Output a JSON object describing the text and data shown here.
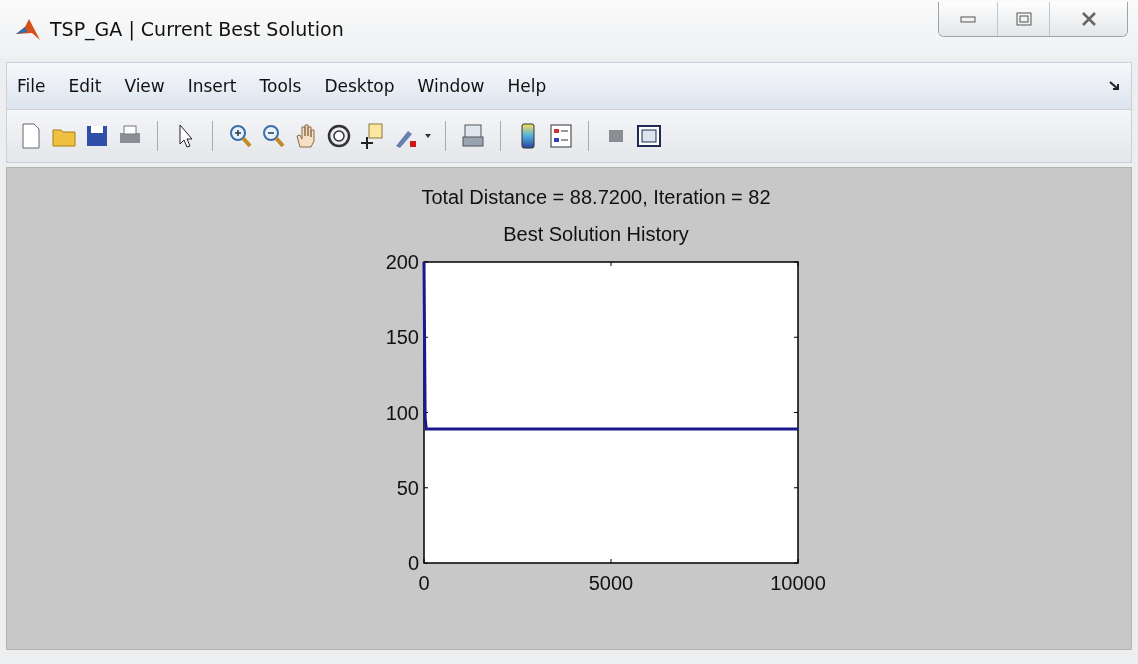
{
  "window": {
    "title": "TSP_GA | Current Best Solution"
  },
  "menu": [
    "File",
    "Edit",
    "View",
    "Insert",
    "Tools",
    "Desktop",
    "Window",
    "Help"
  ],
  "figure": {
    "heading": "Total Distance = 88.7200, Iteration = 82",
    "chart_data": {
      "type": "line",
      "title": "Best Solution History",
      "x": [
        0,
        30,
        60,
        10000
      ],
      "series": [
        {
          "color": "#1a1a8c",
          "values": [
            200,
            97,
            89,
            89
          ]
        }
      ],
      "xlim": [
        0,
        10000
      ],
      "ylim": [
        0,
        200
      ],
      "xticks": [
        0,
        5000,
        10000
      ],
      "yticks": [
        0,
        50,
        100,
        150,
        200
      ]
    }
  }
}
